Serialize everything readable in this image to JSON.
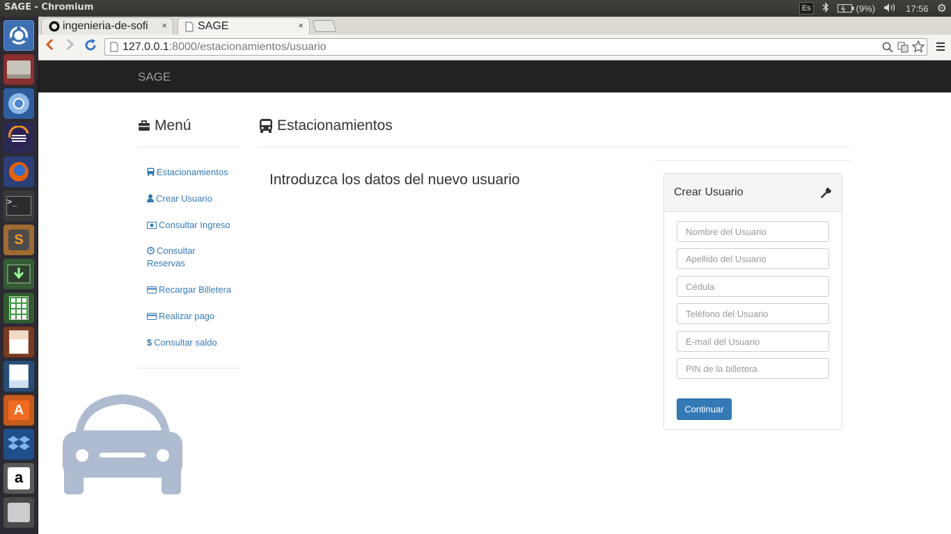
{
  "os": {
    "window_title": "SAGE - Chromium",
    "keyboard_layout": "Es",
    "battery": "(9%)",
    "clock": "17:56"
  },
  "launcher": {
    "items": [
      "dash-icon",
      "files-icon",
      "chromium-icon",
      "eclipse-icon",
      "firefox-icon",
      "terminal-icon",
      "sublime-icon",
      "updater-icon",
      "calc-icon",
      "impress-icon",
      "writer-icon",
      "software-center-icon",
      "dropbox-icon",
      "amazon-icon",
      "trash-icon"
    ]
  },
  "browser": {
    "tabs": [
      {
        "label": "ingenieria-de-sofi"
      },
      {
        "label": "SAGE"
      }
    ],
    "close_glyph": "×",
    "url_host": "127.0.0.1",
    "url_rest": ":8000/estacionamientos/usuario"
  },
  "app": {
    "brand": "SAGE",
    "menu_title": "Menú",
    "main_title": "Estacionamientos",
    "intro": "Introduzca los datos del nuevo usuario",
    "menu": [
      {
        "label": "Estacionamientos",
        "icon": "bus-icon"
      },
      {
        "label": "Crear Usuario",
        "icon": "user-icon"
      },
      {
        "label": "Consultar Ingreso",
        "icon": "money-icon"
      },
      {
        "label": "Consultar Reservas",
        "icon": "clock-icon"
      },
      {
        "label": "Recargar Billetera",
        "icon": "credit-card-icon"
      },
      {
        "label": "Realizar pago",
        "icon": "credit-card-icon"
      },
      {
        "label": "Consultar saldo",
        "icon": "dollar-icon"
      }
    ],
    "panel": {
      "title": "Crear Usuario",
      "fields": {
        "nombre": "Nombre del Usuario",
        "apellido": "Apellido del Usuario",
        "cedula": "Cédula",
        "telefono": "Teléfono del Usuario",
        "email": "E-mail del Usuario",
        "pin": "PIN de la billetera"
      },
      "submit": "Continuar"
    },
    "colors": {
      "navbar": "#222222",
      "link": "#337ab7",
      "button": "#337ab7",
      "car": "#aebbd0"
    }
  }
}
